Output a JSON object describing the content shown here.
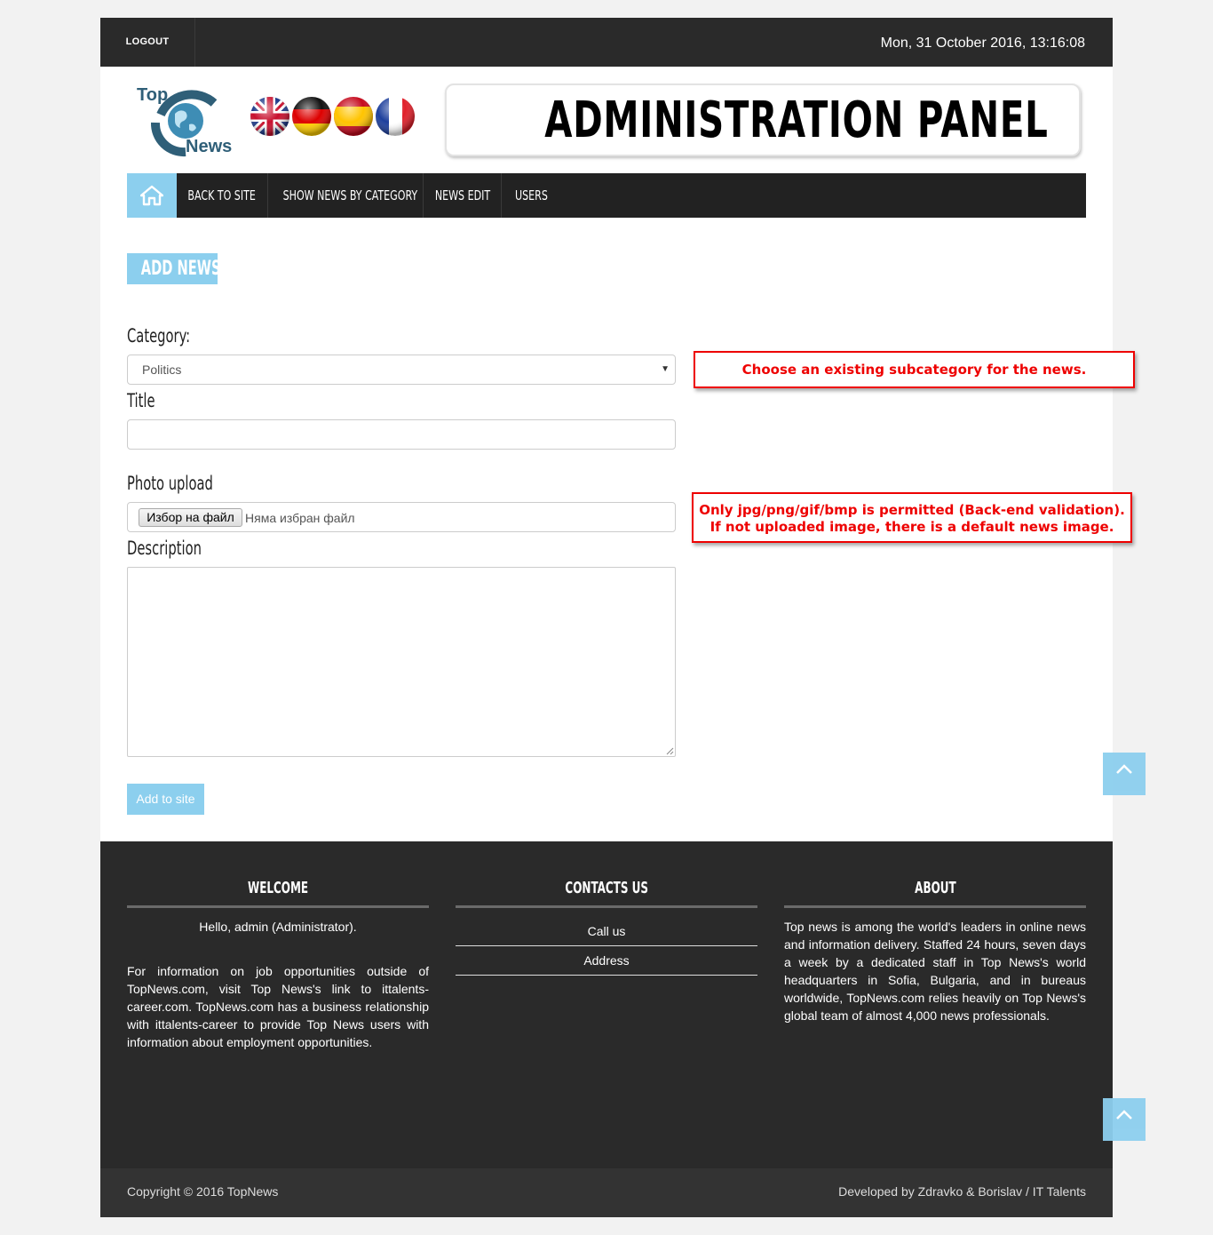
{
  "topbar": {
    "logout_label": "LOGOUT",
    "datetime": "Mon, 31 October 2016, 13:16:08"
  },
  "logo": {
    "line1": "Top",
    "line2": "News"
  },
  "banner": {
    "title": "ADMINISTRATION PANEL"
  },
  "nav": {
    "home_icon": "home-icon",
    "items": [
      "BACK TO SITE",
      "SHOW NEWS BY CATEGORY",
      "NEWS EDIT",
      "USERS"
    ]
  },
  "form": {
    "heading": "ADD NEWS",
    "category_label": "Category:",
    "category_value": "Politics",
    "title_label": "Title",
    "title_value": "",
    "photo_label": "Photo upload",
    "file_button": "Избор на файл",
    "file_status": "Няма избран файл",
    "description_label": "Description",
    "description_value": "",
    "submit_label": "Add to site"
  },
  "notes": {
    "category_note": "Choose an existing subcategory for the news.",
    "photo_note_line1": "Only jpg/png/gif/bmp is permitted (Back-end validation).",
    "photo_note_line2": "If not uploaded image, there is a default news image."
  },
  "footer": {
    "welcome": {
      "heading": "WELCOME",
      "greeting": "Hello, admin (Administrator).",
      "text": "For information on job opportunities outside of TopNews.com, visit Top News's link to ittalents-career.com. TopNews.com has a business relationship with ittalents-career to provide Top News users with information about employment opportunities."
    },
    "contacts": {
      "heading": "CONTACTS US",
      "items": [
        "Call us",
        "Address"
      ]
    },
    "about": {
      "heading": "ABOUT",
      "text": "Top news is among the world's leaders in online news and information delivery. Staffed 24 hours, seven days a week by a dedicated staff in Top News's world headquarters in Sofia, Bulgaria, and in bureaus worldwide, TopNews.com relies heavily on Top News's global team of almost 4,000 news professionals."
    },
    "copyright": "Copyright © 2016 TopNews",
    "developed_by": "Developed by Zdravko & Borislav / IT Talents"
  },
  "colors": {
    "accent": "#8ccfee",
    "dark": "#2a2a2a",
    "note_red": "#e00000"
  }
}
